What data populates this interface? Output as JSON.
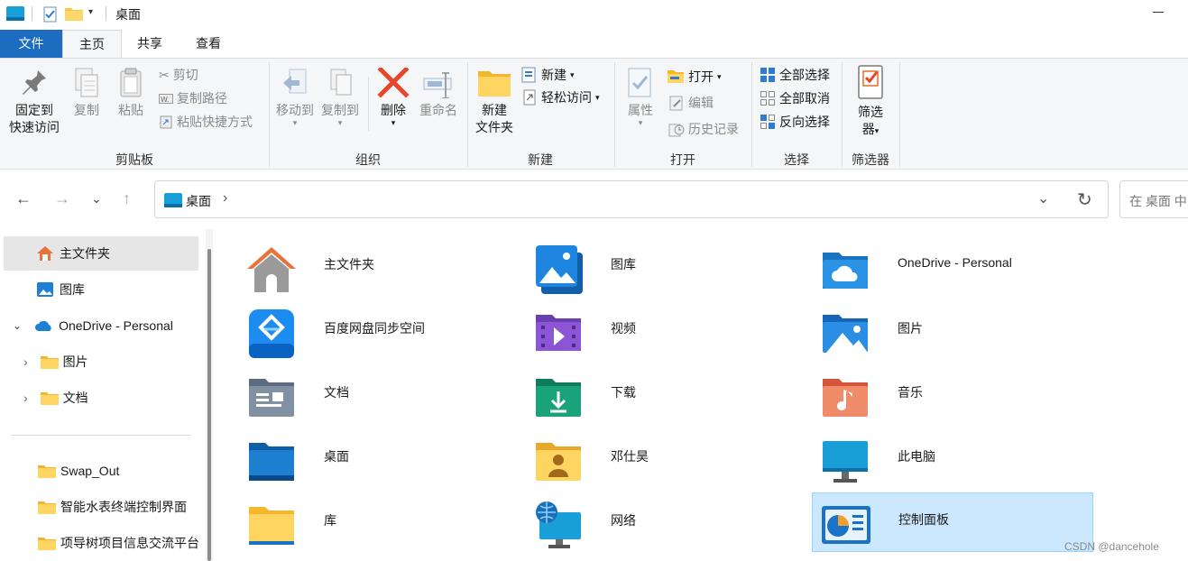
{
  "titlebar": {
    "title": "桌面"
  },
  "tabs": {
    "file": "文件",
    "home": "主页",
    "share": "共享",
    "view": "查看"
  },
  "ribbon": {
    "clipboard": {
      "pin_line1": "固定到",
      "pin_line2": "快速访问",
      "copy": "复制",
      "paste": "粘贴",
      "cut": "剪切",
      "copy_path": "复制路径",
      "paste_shortcut": "粘贴快捷方式",
      "label": "剪贴板"
    },
    "organize": {
      "move_to": "移动到",
      "copy_to": "复制到",
      "delete": "删除",
      "rename": "重命名",
      "label": "组织"
    },
    "new": {
      "new_folder_line1": "新建",
      "new_folder_line2": "文件夹",
      "new_item": "新建",
      "easy_access": "轻松访问",
      "label": "新建"
    },
    "open": {
      "properties": "属性",
      "open": "打开",
      "edit": "编辑",
      "history": "历史记录",
      "label": "打开"
    },
    "select": {
      "select_all": "全部选择",
      "select_none": "全部取消",
      "invert": "反向选择",
      "label": "选择"
    },
    "filter": {
      "filter_line1": "筛选",
      "filter_line2": "器",
      "label": "筛选器"
    }
  },
  "address": {
    "path": "桌面",
    "search_placeholder": "在 桌面 中"
  },
  "sidebar": {
    "items": [
      {
        "label": "主文件夹",
        "icon": "home-icon"
      },
      {
        "label": "图库",
        "icon": "gallery-icon"
      },
      {
        "label": "OneDrive - Personal",
        "icon": "onedrive-icon"
      },
      {
        "label": "图片",
        "icon": "folder-icon"
      },
      {
        "label": "文档",
        "icon": "folder-icon"
      },
      {
        "label": "Swap_Out",
        "icon": "folder-icon"
      },
      {
        "label": "智能水表终端控制界面",
        "icon": "folder-icon"
      },
      {
        "label": "项导树项目信息交流平台",
        "icon": "folder-icon"
      }
    ]
  },
  "content": {
    "items": [
      {
        "label": "主文件夹",
        "icon": "home-icon"
      },
      {
        "label": "图库",
        "icon": "gallery-icon"
      },
      {
        "label": "OneDrive - Personal",
        "icon": "onedrive-folder-icon"
      },
      {
        "label": "百度网盘同步空间",
        "icon": "baidu-netdisk-icon"
      },
      {
        "label": "视频",
        "icon": "videos-folder-icon"
      },
      {
        "label": "图片",
        "icon": "pictures-folder-icon"
      },
      {
        "label": "文档",
        "icon": "documents-folder-icon"
      },
      {
        "label": "下载",
        "icon": "downloads-folder-icon"
      },
      {
        "label": "音乐",
        "icon": "music-folder-icon"
      },
      {
        "label": "桌面",
        "icon": "desktop-folder-icon"
      },
      {
        "label": "邓仕昊",
        "icon": "user-folder-icon"
      },
      {
        "label": "此电脑",
        "icon": "this-pc-icon"
      },
      {
        "label": "库",
        "icon": "libraries-folder-icon"
      },
      {
        "label": "网络",
        "icon": "network-icon"
      },
      {
        "label": "控制面板",
        "icon": "control-panel-icon"
      }
    ]
  },
  "watermark": "CSDN @dancehole"
}
